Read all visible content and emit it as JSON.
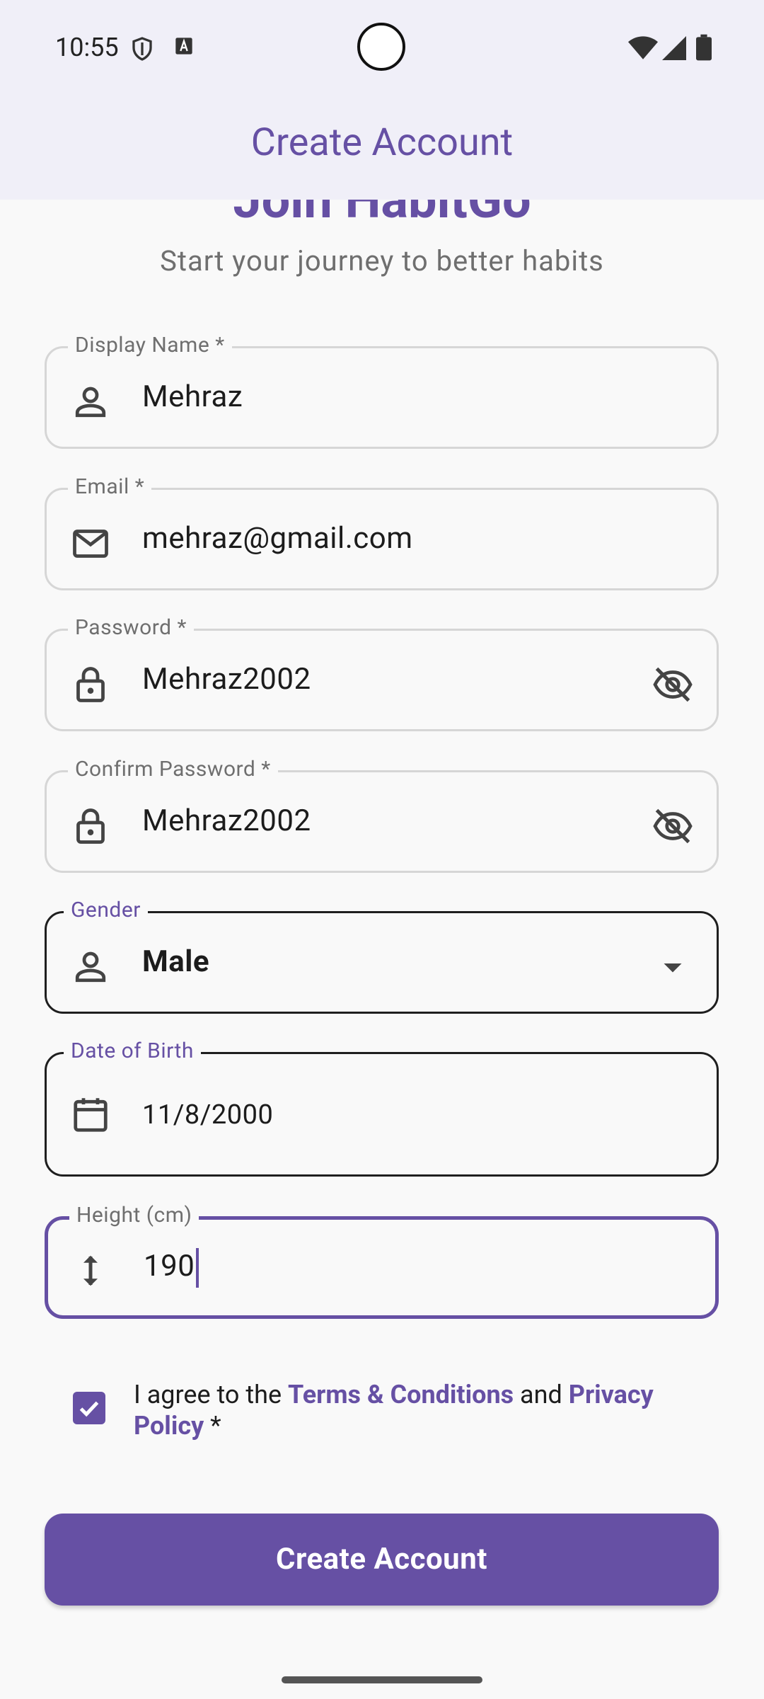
{
  "status_bar": {
    "time": "10:55"
  },
  "app_bar": {
    "title": "Create Account"
  },
  "header": {
    "heading": "Join HabitGo",
    "subtitle": "Start your journey to better habits"
  },
  "form": {
    "display_name": {
      "label": "Display Name *",
      "value": "Mehraz",
      "icon": "person-icon"
    },
    "email": {
      "label": "Email *",
      "value": "mehraz@gmail.com",
      "icon": "mail-icon"
    },
    "password": {
      "label": "Password *",
      "value": "Mehraz2002",
      "icon": "lock-icon"
    },
    "confirm_password": {
      "label": "Confirm Password *",
      "value": "Mehraz2002",
      "icon": "lock-icon"
    },
    "gender": {
      "label": "Gender",
      "value": "Male",
      "icon": "person-icon"
    },
    "dob": {
      "label": "Date of Birth",
      "value": "11/8/2000",
      "icon": "calendar-icon"
    },
    "height": {
      "label": "Height (cm)",
      "value": "190",
      "icon": "vertical-arrows-icon"
    }
  },
  "agreement": {
    "checked": true,
    "prefix": "I agree to the ",
    "terms": "Terms & Conditions",
    "middle": " and ",
    "privacy": "Privacy Policy",
    "suffix": " *"
  },
  "submit": {
    "label": "Create Account"
  },
  "colors": {
    "accent": "#6650a4",
    "bar_bg": "#f0eff8",
    "page_bg": "#f9f9f9"
  }
}
